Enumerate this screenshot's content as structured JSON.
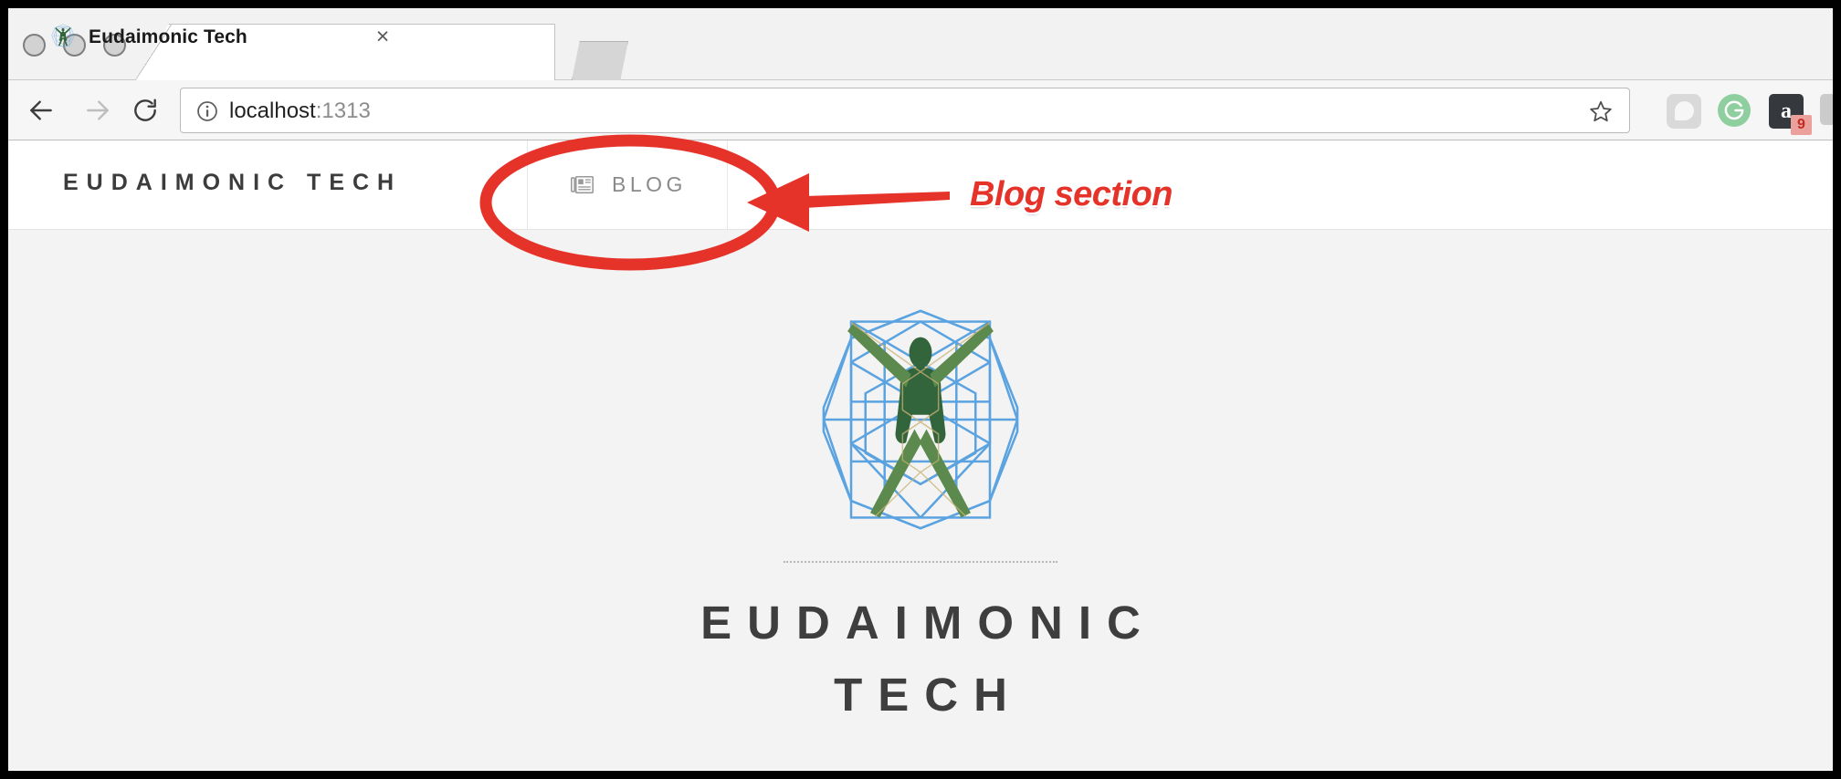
{
  "browser": {
    "traffic_lights": [
      "close",
      "minimize",
      "zoom"
    ],
    "tab": {
      "title": "Eudaimonic Tech",
      "favicon": "eudaimonic-logo-icon",
      "close_label": "×"
    },
    "new_tab_stub": "",
    "toolbar": {
      "back_icon": "arrow-left-icon",
      "forward_icon": "arrow-right-icon",
      "reload_icon": "reload-icon",
      "info_icon": "info-circle-icon",
      "url_host": "localhost",
      "url_port": ":1313",
      "url_full": "localhost:1313",
      "bookmark_icon": "star-icon",
      "extensions": [
        {
          "name": "pocket-extension-icon",
          "badge": ""
        },
        {
          "name": "grammarly-extension-icon",
          "glyph": "G",
          "badge": ""
        },
        {
          "name": "amazon-assistant-extension-icon",
          "glyph": "a",
          "badge": "9"
        },
        {
          "name": "extension-icon",
          "badge": ""
        }
      ]
    }
  },
  "page": {
    "header": {
      "brand": "EUDAIMONIC TECH",
      "nav": [
        {
          "label": "BLOG",
          "icon": "newspaper-icon"
        }
      ]
    },
    "hero": {
      "logo_alt": "eudaimonic-tech-vitruvian-logo",
      "title_line_1": "EUDAIMONIC",
      "title_line_2": "TECH"
    }
  },
  "annotation": {
    "label": "Blog section",
    "color": "#e6332a",
    "shapes": [
      "ellipse-highlight",
      "left-arrow"
    ]
  },
  "colors": {
    "page_background": "#f3f3f3",
    "header_background": "#ffffff",
    "brand_text": "#3c3c3c",
    "nav_text": "#8a8a8a",
    "title_text": "#3e3e3e",
    "annotation_red": "#e6332a",
    "logo_green": "#33653c",
    "logo_blue": "#5ba3e0",
    "chrome_toolbar": "#f6f6f6",
    "chrome_tabstrip": "#f2f2f2"
  }
}
